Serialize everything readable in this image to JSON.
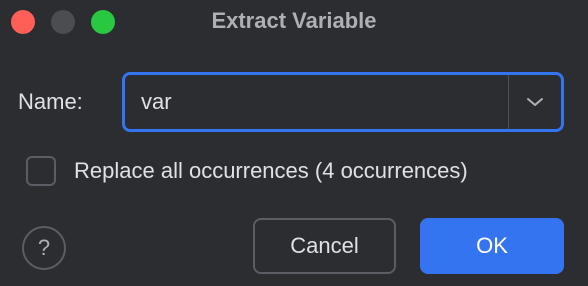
{
  "window": {
    "title": "Extract Variable"
  },
  "form": {
    "name_label": "Name:",
    "name_value": "var"
  },
  "options": {
    "replace_all_label": "Replace all occurrences (4 occurrences)",
    "replace_all_checked": false
  },
  "footer": {
    "help_label": "?",
    "cancel_label": "Cancel",
    "ok_label": "OK"
  },
  "colors": {
    "accent": "#3574f0",
    "background": "#2b2d30",
    "close": "#ff5f57",
    "minimize": "#4c4d50",
    "maximize": "#28c840"
  }
}
